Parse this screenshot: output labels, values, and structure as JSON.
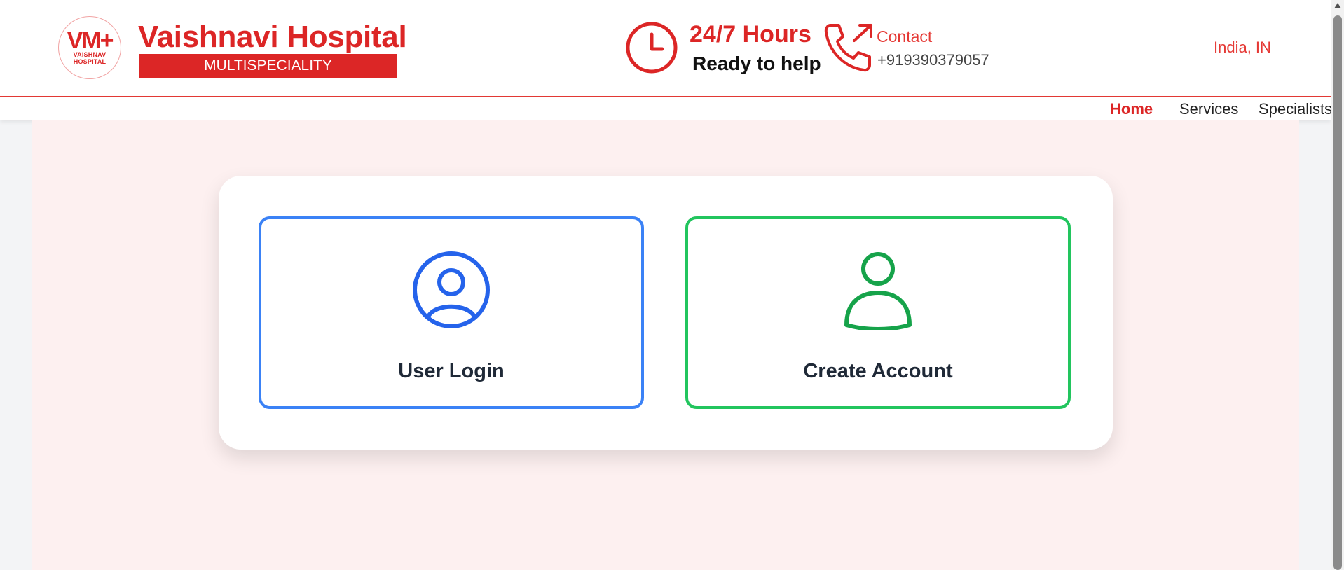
{
  "brand": {
    "logo_mark": "VM+",
    "logo_line1": "VAISHNAV",
    "logo_line2": "HOSPITAL",
    "name": "Vaishnavi Hospital",
    "tagline": "MULTISPECIALITY"
  },
  "availability": {
    "title": "24/7 Hours",
    "subtitle": "Ready to help",
    "icon": "clock-icon"
  },
  "contact": {
    "label": "Contact",
    "phone": "+919390379057",
    "icon": "phone-outgoing-icon"
  },
  "region": "India, IN",
  "nav": {
    "items": [
      {
        "label": "Home",
        "active": true
      },
      {
        "label": "Services",
        "active": false
      },
      {
        "label": "Specialists",
        "active": false
      }
    ]
  },
  "options": {
    "login": {
      "label": "User Login",
      "icon": "user-circle-icon",
      "color": "#2563eb"
    },
    "create": {
      "label": "Create Account",
      "icon": "user-icon",
      "color": "#16a34a"
    }
  },
  "colors": {
    "brand_red": "#dc2626",
    "login_border": "#3b82f6",
    "create_border": "#22c55e",
    "page_tint": "#fdf0f0"
  }
}
